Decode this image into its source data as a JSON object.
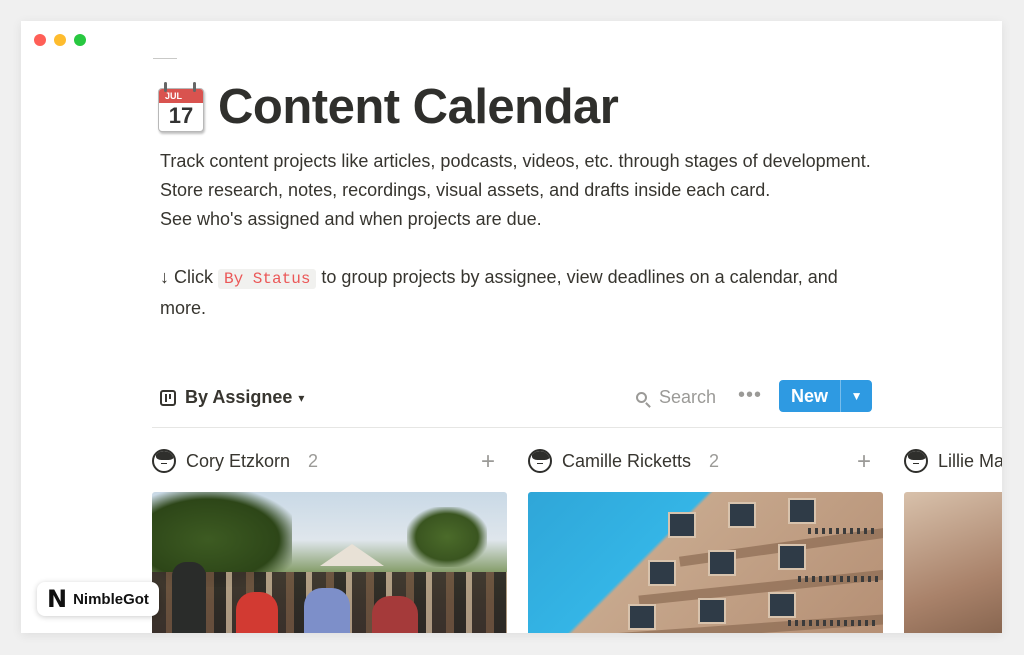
{
  "window": {
    "buttons": [
      "close",
      "minimize",
      "zoom"
    ]
  },
  "page": {
    "icon": "calendar-icon",
    "icon_month": "JUL",
    "icon_day": "17",
    "title": "Content Calendar",
    "description": [
      "Track content projects like articles, podcasts, videos, etc. through stages of development.",
      "Store research, notes, recordings, visual assets, and drafts inside each card.",
      "See who's assigned and when projects are due."
    ],
    "hint": {
      "prefix": "↓ Click ",
      "code": "By Status",
      "suffix": " to group projects by assignee, view deadlines on a calendar, and more."
    }
  },
  "toolbar": {
    "view_label": "By Assignee",
    "search_label": "Search",
    "more_label": "•••",
    "new_label": "New"
  },
  "columns": [
    {
      "name": "Cory Etzkorn",
      "count": "2"
    },
    {
      "name": "Camille Ricketts",
      "count": "2"
    },
    {
      "name": "Lillie Ma",
      "count": ""
    }
  ],
  "badge": {
    "logo_letter": "N",
    "text": "NimbleGot"
  },
  "colors": {
    "accent": "#2e9ae2",
    "code_text": "#eb5757",
    "background": "#ffffff"
  }
}
